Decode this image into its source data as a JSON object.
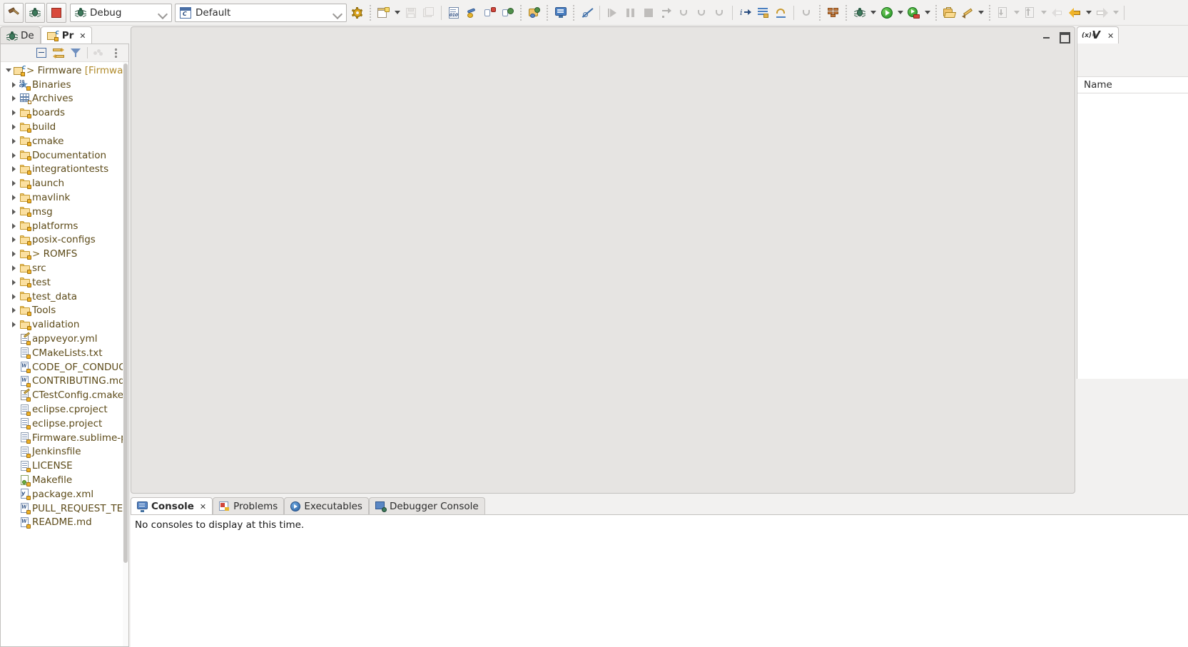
{
  "toolbar": {
    "buttons": [
      {
        "name": "build-button",
        "icon": "hammer-icon"
      },
      {
        "name": "debug-button",
        "icon": "bug-icon"
      },
      {
        "name": "stop-button",
        "icon": "stop-icon"
      }
    ],
    "launch_mode_combo": {
      "value": "Debug",
      "icon": "bug-icon"
    },
    "launch_config_combo": {
      "value": "Default",
      "icon": "launch-config-icon"
    },
    "gear_label": "manage-configurations"
  },
  "left_panel": {
    "tabs": [
      {
        "label": "De",
        "icon": "bug-icon",
        "active": false
      },
      {
        "label": "Pr",
        "icon": "project-explorer-icon",
        "active": true
      }
    ],
    "view_toolbar": [
      {
        "name": "collapse-all-button",
        "icon": "collapse-all-icon"
      },
      {
        "name": "link-with-editor-button",
        "icon": "link-editor-icon"
      },
      {
        "name": "filters-button",
        "icon": "funnel-icon"
      },
      {
        "name": "more-button",
        "icon": "dots-icon"
      },
      {
        "name": "view-menu-button",
        "icon": "view-menu-icon"
      }
    ],
    "tree": [
      {
        "label": "Firmware",
        "suffix": " [Firmware sq",
        "prefix": "> ",
        "icon": "project-icon",
        "twisty": "open",
        "indent": 0
      },
      {
        "label": "Binaries",
        "icon": "binaries-icon",
        "twisty": "closed",
        "indent": 1
      },
      {
        "label": "Archives",
        "icon": "archives-icon",
        "twisty": "closed",
        "indent": 1
      },
      {
        "label": "boards",
        "icon": "folder-icon",
        "twisty": "closed",
        "indent": 1
      },
      {
        "label": "build",
        "icon": "folder-question-icon",
        "twisty": "closed",
        "indent": 1
      },
      {
        "label": "cmake",
        "icon": "folder-icon",
        "twisty": "closed",
        "indent": 1
      },
      {
        "label": "Documentation",
        "icon": "folder-icon",
        "twisty": "closed",
        "indent": 1
      },
      {
        "label": "integrationtests",
        "icon": "folder-icon",
        "twisty": "closed",
        "indent": 1
      },
      {
        "label": "launch",
        "icon": "folder-icon",
        "twisty": "closed",
        "indent": 1
      },
      {
        "label": "mavlink",
        "icon": "folder-icon",
        "twisty": "closed",
        "indent": 1
      },
      {
        "label": "msg",
        "icon": "folder-icon",
        "twisty": "closed",
        "indent": 1
      },
      {
        "label": "platforms",
        "icon": "folder-icon",
        "twisty": "closed",
        "indent": 1
      },
      {
        "label": "posix-configs",
        "icon": "folder-icon",
        "twisty": "closed",
        "indent": 1
      },
      {
        "label": "ROMFS",
        "prefix": "> ",
        "icon": "folder-icon",
        "twisty": "closed",
        "indent": 1
      },
      {
        "label": "src",
        "icon": "folder-icon",
        "twisty": "closed",
        "indent": 1
      },
      {
        "label": "test",
        "icon": "folder-icon",
        "twisty": "closed",
        "indent": 1
      },
      {
        "label": "test_data",
        "icon": "folder-icon",
        "twisty": "closed",
        "indent": 1
      },
      {
        "label": "Tools",
        "icon": "folder-icon",
        "twisty": "closed",
        "indent": 1
      },
      {
        "label": "validation",
        "icon": "folder-icon",
        "twisty": "closed",
        "indent": 1
      },
      {
        "label": "appveyor.yml",
        "icon": "file-edit-icon",
        "twisty": "none",
        "indent": 1
      },
      {
        "label": "CMakeLists.txt",
        "icon": "file-icon",
        "twisty": "none",
        "indent": 1
      },
      {
        "label": "CODE_OF_CONDUCT.m",
        "icon": "file-markdown-icon",
        "twisty": "none",
        "indent": 1
      },
      {
        "label": "CONTRIBUTING.md",
        "icon": "file-markdown-icon",
        "twisty": "none",
        "indent": 1
      },
      {
        "label": "CTestConfig.cmake",
        "icon": "file-edit-icon",
        "twisty": "none",
        "indent": 1
      },
      {
        "label": "eclipse.cproject",
        "icon": "file-icon",
        "twisty": "none",
        "indent": 1
      },
      {
        "label": "eclipse.project",
        "icon": "file-icon",
        "twisty": "none",
        "indent": 1
      },
      {
        "label": "Firmware.sublime-proj",
        "icon": "file-icon",
        "twisty": "none",
        "indent": 1
      },
      {
        "label": "Jenkinsfile",
        "icon": "file-icon",
        "twisty": "none",
        "indent": 1
      },
      {
        "label": "LICENSE",
        "icon": "file-icon",
        "twisty": "none",
        "indent": 1
      },
      {
        "label": "Makefile",
        "icon": "file-make-icon",
        "twisty": "none",
        "indent": 1
      },
      {
        "label": "package.xml",
        "icon": "file-xml-icon",
        "twisty": "none",
        "indent": 1
      },
      {
        "label": "PULL_REQUEST_TEMP",
        "icon": "file-markdown-icon",
        "twisty": "none",
        "indent": 1
      },
      {
        "label": "README.md",
        "icon": "file-markdown-icon",
        "twisty": "none",
        "indent": 1
      }
    ]
  },
  "editor": {
    "minimize_label": "minimize-editor",
    "maximize_label": "maximize-editor"
  },
  "console_panel": {
    "tabs": [
      {
        "label": "Console",
        "icon": "console-icon",
        "active": true,
        "closable": true
      },
      {
        "label": "Problems",
        "icon": "problems-icon",
        "active": false,
        "closable": false
      },
      {
        "label": "Executables",
        "icon": "executables-icon",
        "active": false,
        "closable": false
      },
      {
        "label": "Debugger Console",
        "icon": "debugger-console-icon",
        "active": false,
        "closable": false
      }
    ],
    "empty_message": "No consoles to display at this time."
  },
  "right_panel": {
    "tab": {
      "label": "V",
      "icon": "variables-icon",
      "prefix": "(x)=",
      "closable": true
    },
    "columns": [
      "Name"
    ]
  },
  "colors": {
    "tree_text": "#5c4a18",
    "chrome": "#f2f1f0",
    "panel_bg": "#ffffff",
    "editor_bg": "#e6e4e2",
    "accent_folder": "#f0b429"
  }
}
